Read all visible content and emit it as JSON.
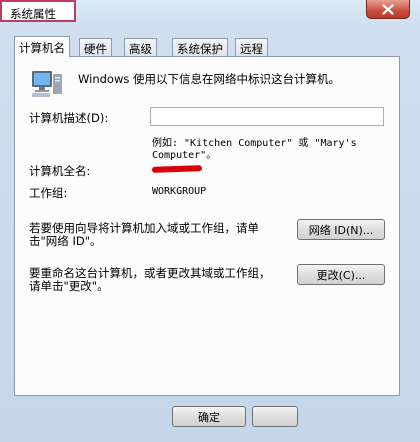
{
  "window": {
    "title": "系统属性"
  },
  "tabs": [
    {
      "label": "计算机名",
      "active": true
    },
    {
      "label": "硬件",
      "active": false
    },
    {
      "label": "高级",
      "active": false
    },
    {
      "label": "系统保护",
      "active": false
    },
    {
      "label": "远程",
      "active": false
    }
  ],
  "computer_name": {
    "intro": "Windows 使用以下信息在网络中标识这台计算机。",
    "description_label": "计算机描述(D):",
    "description_value": "",
    "example_line1": "例如: \"Kitchen Computer\" 或 \"Mary's",
    "example_line2": "Computer\"。",
    "full_name_label": "计算机全名:",
    "workgroup_label": "工作组:",
    "workgroup_value": "WORKGROUP",
    "network_id_text_line1": "若要使用向导将计算机加入域或工作组，请单",
    "network_id_text_line2": "击\"网络 ID\"。",
    "network_id_button": "网络 ID(N)...",
    "rename_text_line1": "要重命名这台计算机，或者更改其域或工作组，",
    "rename_text_line2": "请单击\"更改\"。",
    "change_button": "更改(C)..."
  },
  "footer": {
    "ok_button": "确定"
  },
  "colors": {
    "highlight_border": "#c23a5c",
    "redaction": "#d8000a"
  }
}
